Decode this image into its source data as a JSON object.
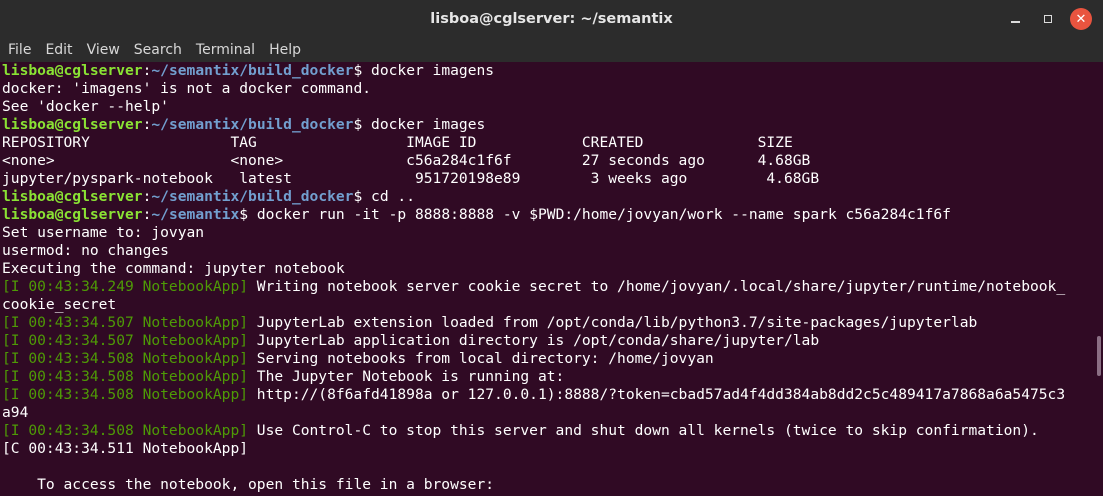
{
  "window": {
    "title": "lisboa@cglserver: ~/semantix",
    "minimize_glyph": "",
    "maximize_glyph": "",
    "close_glyph": "✕"
  },
  "menu": {
    "items": [
      "File",
      "Edit",
      "View",
      "Search",
      "Terminal",
      "Help"
    ]
  },
  "colors": {
    "background": "#300a24",
    "user_host": "#8ae234",
    "path": "#729fcf",
    "log_prefix": "#4e9a06",
    "text": "#ffffff",
    "close_button": "#e9543f"
  },
  "terminal": {
    "lines": [
      {
        "user": "lisboa@cglserver",
        "sep": ":",
        "path": "~/semantix/build_docker",
        "cmd": "$ docker imagens"
      },
      {
        "text": "docker: 'imagens' is not a docker command."
      },
      {
        "text": "See 'docker --help'"
      },
      {
        "user": "lisboa@cglserver",
        "sep": ":",
        "path": "~/semantix/build_docker",
        "cmd": "$ docker images"
      },
      {
        "text": "REPOSITORY                TAG                 IMAGE ID            CREATED             SIZE"
      },
      {
        "text": "<none>                    <none>              c56a284c1f6f        27 seconds ago      4.68GB"
      },
      {
        "text": "jupyter/pyspark-notebook   latest              951720198e89        3 weeks ago         4.68GB"
      },
      {
        "user": "lisboa@cglserver",
        "sep": ":",
        "path": "~/semantix/build_docker",
        "cmd": "$ cd .."
      },
      {
        "user": "lisboa@cglserver",
        "sep": ":",
        "path": "~/semantix",
        "cmd": "$ docker run -it -p 8888:8888 -v $PWD:/home/jovyan/work --name spark c56a284c1f6f"
      },
      {
        "text": "Set username to: jovyan"
      },
      {
        "text": "usermod: no changes"
      },
      {
        "text": "Executing the command: jupyter notebook"
      },
      {
        "log": "[I 00:43:34.249 NotebookApp]",
        "text": " Writing notebook server cookie secret to /home/jovyan/.local/share/jupyter/runtime/notebook_"
      },
      {
        "text": "cookie_secret"
      },
      {
        "log": "[I 00:43:34.507 NotebookApp]",
        "text": " JupyterLab extension loaded from /opt/conda/lib/python3.7/site-packages/jupyterlab"
      },
      {
        "log": "[I 00:43:34.507 NotebookApp]",
        "text": " JupyterLab application directory is /opt/conda/share/jupyter/lab"
      },
      {
        "log": "[I 00:43:34.508 NotebookApp]",
        "text": " Serving notebooks from local directory: /home/jovyan"
      },
      {
        "log": "[I 00:43:34.508 NotebookApp]",
        "text": " The Jupyter Notebook is running at:"
      },
      {
        "log": "[I 00:43:34.508 NotebookApp]",
        "text": " http://(8f6afd41898a or 127.0.0.1):8888/?token=cbad57ad4f4dd384ab8dd2c5c489417a7868a6a5475c3"
      },
      {
        "text": "a94"
      },
      {
        "log": "[I 00:43:34.508 NotebookApp]",
        "text": " Use Control-C to stop this server and shut down all kernels (twice to skip confirmation)."
      },
      {
        "text": "[C 00:43:34.511 NotebookApp]"
      },
      {
        "text": ""
      },
      {
        "text": "    To access the notebook, open this file in a browser:"
      }
    ]
  }
}
